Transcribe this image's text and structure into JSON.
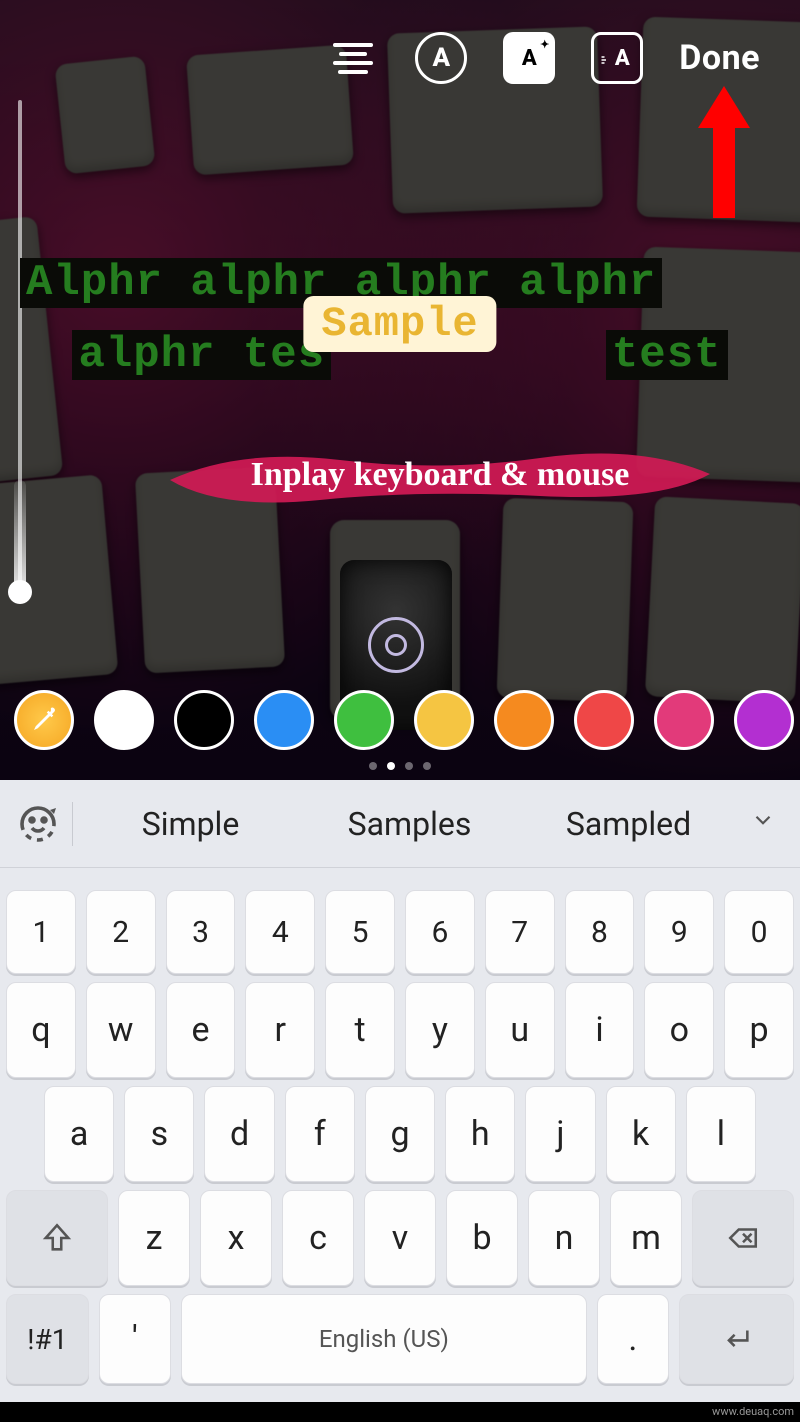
{
  "toolbar": {
    "align_tool": "align-center",
    "font_tool": "A",
    "effects_tool": "A✦",
    "animation_tool": "A",
    "done_label": "Done"
  },
  "annotation": {
    "arrow_target": "done-button"
  },
  "story_text": {
    "bg_line1": "Alphr alphr alphr alphr",
    "bg_line2_left": "alphr tes",
    "bg_line2_right": "test",
    "overlay_text": "Sample",
    "brush_label": "Inplay keyboard & mouse"
  },
  "palette": {
    "eyedropper": true,
    "colors": [
      "#ffffff",
      "#000000",
      "#2a8ef4",
      "#3fbf3f",
      "#f5c542",
      "#f58a1f",
      "#ef4747",
      "#e23a7a",
      "#b32fd1"
    ],
    "page_indicator": {
      "count": 4,
      "active_index": 1
    }
  },
  "keyboard": {
    "suggestions": [
      "Simple",
      "Samples",
      "Sampled"
    ],
    "row_numbers": [
      "1",
      "2",
      "3",
      "4",
      "5",
      "6",
      "7",
      "8",
      "9",
      "0"
    ],
    "row1": [
      "q",
      "w",
      "e",
      "r",
      "t",
      "y",
      "u",
      "i",
      "o",
      "p"
    ],
    "row2": [
      "a",
      "s",
      "d",
      "f",
      "g",
      "h",
      "j",
      "k",
      "l"
    ],
    "row3": [
      "z",
      "x",
      "c",
      "v",
      "b",
      "n",
      "m"
    ],
    "symbols_label": "!#1",
    "quote_key": "'",
    "dot_key": ".",
    "space_label": "English (US)"
  },
  "watermark": "www.deuaq.com"
}
